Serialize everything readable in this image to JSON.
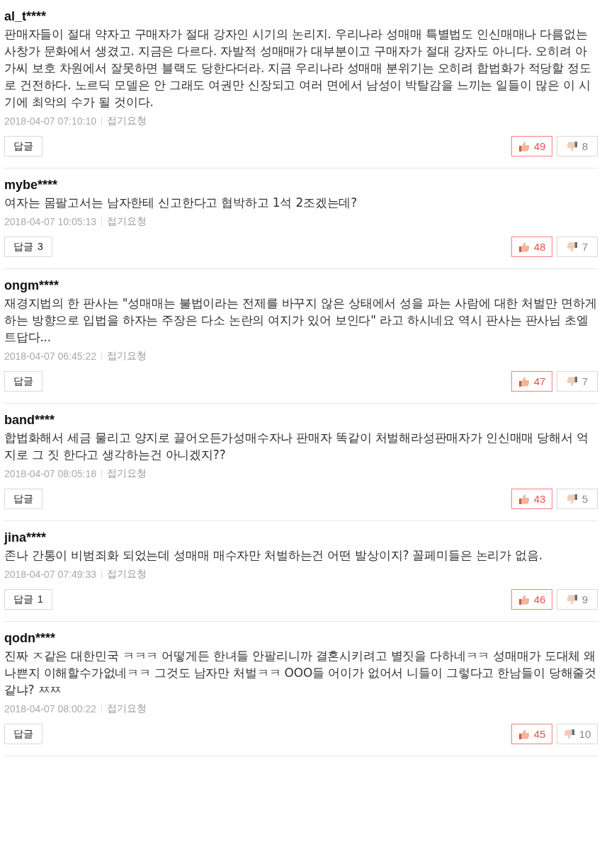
{
  "comments": [
    {
      "user": "al_t****",
      "text": "판매자들이 절대 약자고 구매자가 절대 강자인 시기의 논리지. 우리나라 성매매 특별법도 인신매매나 다름없는 사창가 문화에서 생겼고. 지금은 다르다. 자발적 성매매가 대부분이고 구매자가 절대 강자도 아니다. 오히려 아가씨 보호 차원에서 잘못하면 블랙도 당한다더라. 지금 우리나라 성매매 분위기는 오히려 합법화가 적당할 정도로 건전하다. 노르딕 모델은 안 그래도 여권만 신장되고 여러 면에서 남성이 박탈감을 느끼는 일들이 많은 이 시기에 최악의 수가 될 것이다.",
      "date": "2018-04-07 07:10:10",
      "report": "접기요청",
      "reply": "답글",
      "likes": "49",
      "dislikes": "8"
    },
    {
      "user": "mybe****",
      "text": "여자는 몸팔고서는 남자한테 신고한다고 협박하고 1석 2조겠는데?",
      "date": "2018-04-07 10:05:13",
      "report": "접기요청",
      "reply": "답글",
      "reply_count": "3",
      "likes": "48",
      "dislikes": "7"
    },
    {
      "user": "ongm****",
      "text": "재경지법의 한 판사는 \"성매매는 불법이라는 전제를 바꾸지 않은 상태에서 성을 파는 사람에 대한 처벌만 면하게 하는 방향으로 입법을 하자는 주장은 다소 논란의 여지가 있어 보인다\" 라고 하시네요 역시 판사는 판사님 초엘트답다...",
      "date": "2018-04-07 06:45:22",
      "report": "접기요청",
      "reply": "답글",
      "likes": "47",
      "dislikes": "7"
    },
    {
      "user": "band****",
      "text": "합법화해서 세금 물리고 양지로 끌어오든가성매수자나 판매자 똑같이 처벌해라성판매자가 인신매매 당해서 억지로 그 짓 한다고 생각하는건 아니겠지??",
      "date": "2018-04-07 08:05:18",
      "report": "접기요청",
      "reply": "답글",
      "likes": "43",
      "dislikes": "5"
    },
    {
      "user": "jina****",
      "text": "존나 간통이 비범죄화 되었는데 성매매 매수자만 처벌하는건 어떤 발상이지? 꼴페미들은 논리가 없음.",
      "date": "2018-04-07 07:49:33",
      "report": "접기요청",
      "reply": "답글",
      "reply_count": "1",
      "likes": "46",
      "dislikes": "9"
    },
    {
      "user": "qodn****",
      "text": "진짜 ㅈ같은 대한민국 ㅋㅋㅋ 어떻게든 한녀들 안팔리니까 결혼시키려고 별짓을 다하네ㅋㅋ 성매매가 도대체 왜 나쁜지 이해할수가없네ㅋㅋ 그것도 남자만 처벌ㅋㅋ OOO들 어이가 없어서 니들이 그렇다고 한남들이 당해줄것같냐? ㅉㅉ",
      "date": "2018-04-07 08:00:22",
      "report": "접기요청",
      "reply": "답글",
      "likes": "45",
      "dislikes": "10"
    }
  ]
}
